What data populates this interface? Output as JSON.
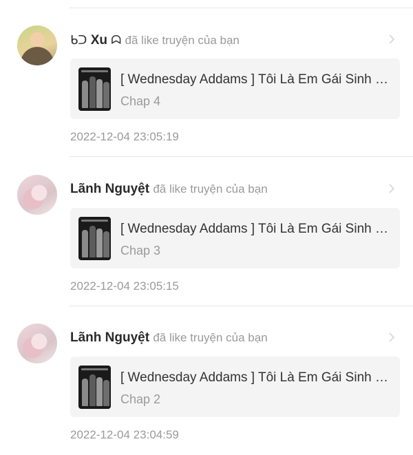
{
  "notifications": [
    {
      "name_prefix": "ᑲᑐ",
      "name": "Xu",
      "name_suffix": "ᗣ",
      "action": "đã like truyện của bạn",
      "story_title": "[ Wednesday Addams ] Tôi Là Em Gái Sinh Đôi Của Wednesday",
      "chapter": "Chap 4",
      "time": "2022-12-04 23:05:19"
    },
    {
      "name_prefix": "",
      "name": "Lãnh Nguyệt",
      "name_suffix": "",
      "action": "đã like truyện của bạn",
      "story_title": "[ Wednesday Addams ] Tôi Là Em Gái Sinh Đôi Của Wednesday",
      "chapter": "Chap 3",
      "time": "2022-12-04 23:05:15"
    },
    {
      "name_prefix": "",
      "name": "Lãnh Nguyệt",
      "name_suffix": "",
      "action": "đã like truyện của bạn",
      "story_title": "[ Wednesday Addams ] Tôi Là Em Gái Sinh Đôi Của Wednesday",
      "chapter": "Chap 2",
      "time": "2022-12-04 23:04:59"
    }
  ],
  "icons": {
    "chevron": "chevron-right-icon"
  },
  "colors": {
    "muted_text": "#999999",
    "card_bg": "#f4f4f4",
    "divider": "#e6e6e6"
  }
}
